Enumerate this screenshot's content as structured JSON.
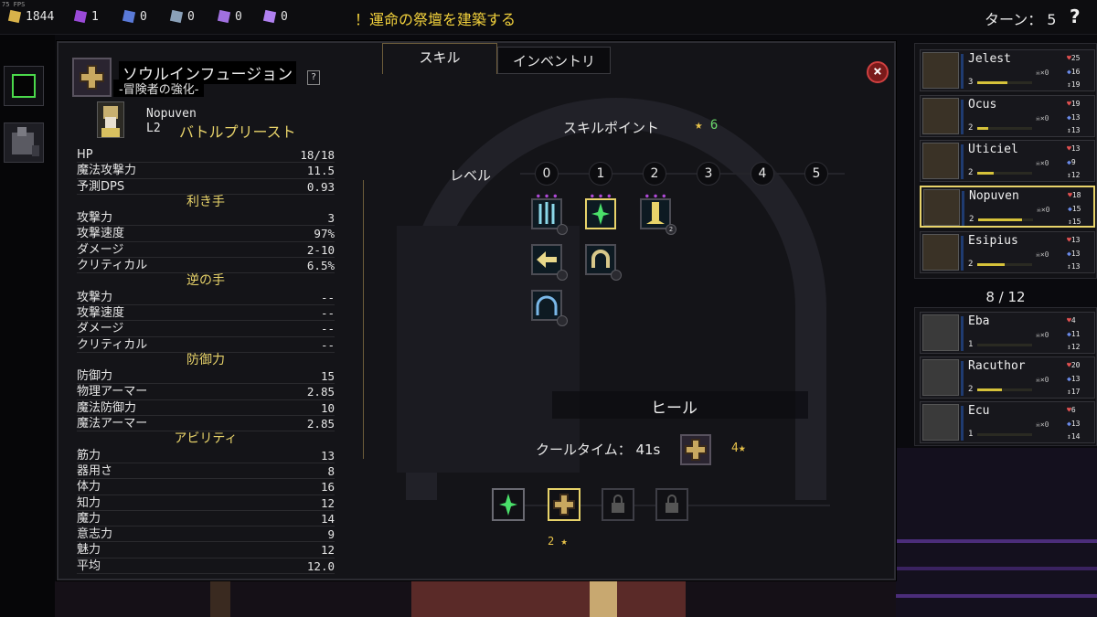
{
  "fps": "75 FPS",
  "resources": [
    {
      "icon": "gold-coins-icon",
      "value": "1844",
      "color": "#d8b24a"
    },
    {
      "icon": "purple-crystal-icon",
      "value": "1",
      "color": "#9a4ad8"
    },
    {
      "icon": "blue-tome-icon",
      "value": "0",
      "color": "#5a7ad8"
    },
    {
      "icon": "rune-stone-icon",
      "value": "0",
      "color": "#8aa0b8"
    },
    {
      "icon": "purple-shard-icon",
      "value": "0",
      "color": "#a070e0"
    },
    {
      "icon": "violet-gem-icon",
      "value": "0",
      "color": "#b080f0"
    }
  ],
  "quest": "！運命の祭壇を建築する",
  "turn": "ターン： 5",
  "help": "?",
  "panel": {
    "title": "ソウルインフュージョン",
    "subtitle": "-冒険者の強化-",
    "question": "?",
    "hero": {
      "name": "Nopuven",
      "level": "L2",
      "class": "バトルプリースト"
    },
    "stats_top": [
      {
        "label": "HP",
        "value": "18/18"
      },
      {
        "label": "魔法攻撃力",
        "value": "11.5"
      },
      {
        "label": "予測DPS",
        "value": "0.93"
      }
    ],
    "main_hand_title": "利き手",
    "main_hand": [
      {
        "label": "攻撃力",
        "value": "3"
      },
      {
        "label": "攻撃速度",
        "value": "97%"
      },
      {
        "label": "ダメージ",
        "value": "2-10"
      },
      {
        "label": "クリティカル",
        "value": "6.5%"
      }
    ],
    "off_hand_title": "逆の手",
    "off_hand": [
      {
        "label": "攻撃力",
        "value": "--"
      },
      {
        "label": "攻撃速度",
        "value": "--"
      },
      {
        "label": "ダメージ",
        "value": "--"
      },
      {
        "label": "クリティカル",
        "value": "--"
      }
    ],
    "defense_title": "防御力",
    "defense": [
      {
        "label": "防御力",
        "value": "15"
      },
      {
        "label": "物理アーマー",
        "value": "2.85"
      },
      {
        "label": "魔法防御力",
        "value": "10"
      },
      {
        "label": "魔法アーマー",
        "value": "2.85"
      }
    ],
    "ability_title": "アビリティ",
    "abilities": [
      {
        "label": "筋力",
        "value": "13"
      },
      {
        "label": "器用さ",
        "value": "8"
      },
      {
        "label": "体力",
        "value": "16"
      },
      {
        "label": "知力",
        "value": "12"
      },
      {
        "label": "魔力",
        "value": "14"
      },
      {
        "label": "意志力",
        "value": "9"
      },
      {
        "label": "魅力",
        "value": "12"
      },
      {
        "label": "平均",
        "value": "12.0"
      }
    ],
    "tabs": [
      "スキル",
      "インベントリ"
    ],
    "skill_points_label": "スキルポイント",
    "skill_points": "6",
    "level_label": "レベル",
    "levels": [
      "0",
      "1",
      "2",
      "3",
      "4",
      "5"
    ],
    "skill_badges": {
      "gold_beam": "2"
    },
    "selected_skill": "ヒール",
    "cooldown_label": "クールタイム： 41s",
    "cooldown_cost": "4",
    "slot_cost": "2"
  },
  "party": [
    {
      "name": "Jelest",
      "level": "3",
      "xp": 0.55,
      "count": "×0",
      "hp": "25",
      "armor": "16",
      "spd": "19"
    },
    {
      "name": "Ocus",
      "level": "2",
      "xp": 0.2,
      "count": "×0",
      "hp": "19",
      "armor": "13",
      "spd": "13"
    },
    {
      "name": "Uticiel",
      "level": "2",
      "xp": 0.3,
      "count": "×0",
      "hp": "13",
      "armor": "9",
      "spd": "12"
    },
    {
      "name": "Nopuven",
      "level": "2",
      "xp": 0.8,
      "count": "×0",
      "hp": "18",
      "armor": "15",
      "spd": "15"
    },
    {
      "name": "Esipius",
      "level": "2",
      "xp": 0.5,
      "count": "×0",
      "hp": "13",
      "armor": "13",
      "spd": "13"
    }
  ],
  "roster_count": "8 / 12",
  "reserve": [
    {
      "name": "Eba",
      "level": "1",
      "xp": 0.0,
      "count": "×0",
      "hp": "4",
      "armor": "11",
      "spd": "12"
    },
    {
      "name": "Racuthor",
      "level": "2",
      "xp": 0.45,
      "count": "×0",
      "hp": "20",
      "armor": "13",
      "spd": "17"
    },
    {
      "name": "Ecu",
      "level": "1",
      "xp": 0.0,
      "count": "×0",
      "hp": "6",
      "armor": "13",
      "spd": "14"
    }
  ]
}
